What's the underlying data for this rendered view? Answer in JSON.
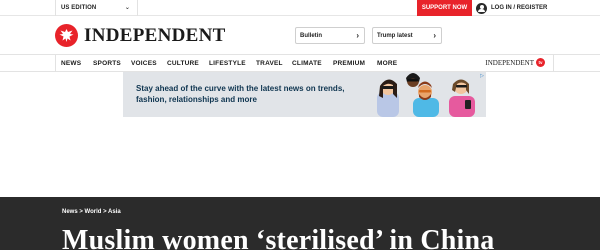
{
  "topbar": {
    "edition": "US EDITION",
    "support": "SUPPORT NOW",
    "login": "LOG IN / REGISTER"
  },
  "header": {
    "logo_text": "INDEPENDENT",
    "pills": [
      "Bulletin",
      "Trump latest"
    ]
  },
  "nav": {
    "items": [
      "NEWS",
      "SPORTS",
      "VOICES",
      "CULTURE",
      "LIFESTYLE",
      "TRAVEL",
      "CLIMATE",
      "PREMIUM",
      "MORE"
    ],
    "tv_logo": "INDEPENDENT",
    "tv_badge": "tv"
  },
  "ad": {
    "text": "Stay ahead of the curve with the latest news on trends, fashion, relationships and more"
  },
  "article": {
    "breadcrumb": "News > World > Asia",
    "headline": "Muslim women ‘sterilised’ in China"
  },
  "colors": {
    "brand_red": "#e8232a",
    "dark_bg": "#2b2b2b",
    "ad_bg": "#e1e4e8"
  }
}
